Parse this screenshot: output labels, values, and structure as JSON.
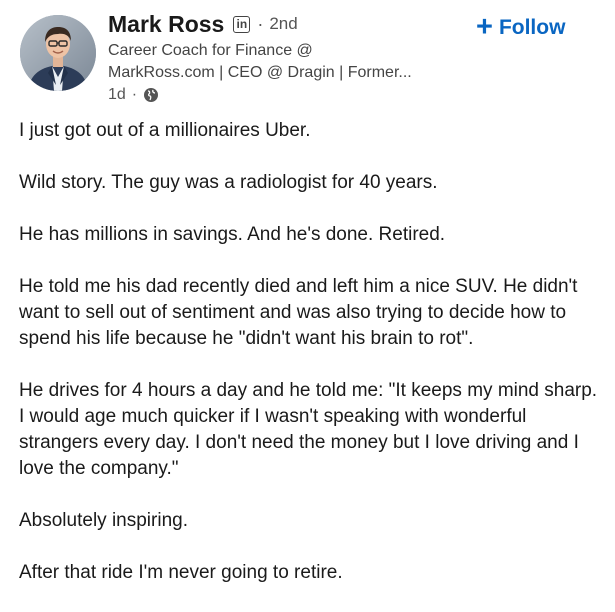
{
  "author": {
    "name": "Mark Ross",
    "network_badge": "in",
    "separator": "·",
    "degree": "2nd",
    "headline_line1": "Career Coach for Finance @",
    "headline_line2": "MarkRoss.com | CEO @ Dragin | Former...",
    "time_ago": "1d",
    "visibility_icon": "globe-icon"
  },
  "actions": {
    "follow_icon": "+",
    "follow_label": "Follow"
  },
  "post": {
    "paragraphs": [
      "I just got out of a millionaires Uber.",
      "Wild story. The guy was a radiologist for 40 years.",
      "He has millions in savings. And he's done. Retired.",
      "He told me his dad recently died and left him a nice SUV. He didn't want to sell out of sentiment and was also trying to decide how to spend his life because he \"didn't want his brain to rot\".",
      "He drives for 4 hours a day and he told me: \"It keeps my mind sharp. I would age much quicker if I wasn't speaking with wonderful strangers every day. I don't need the money but I love driving and I love the company.\"",
      "Absolutely inspiring.",
      "After that ride I'm never going to retire."
    ]
  },
  "colors": {
    "accent": "#0a66c2",
    "text": "#1a1a1a",
    "secondary_text": "#555555"
  }
}
